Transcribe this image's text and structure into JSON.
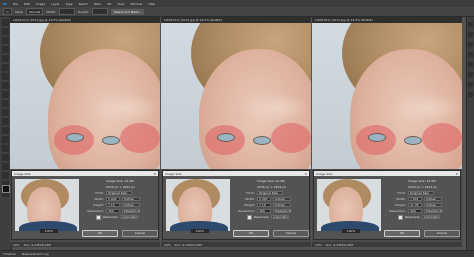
{
  "menu": [
    "File",
    "Edit",
    "Image",
    "Layer",
    "Type",
    "Select",
    "Filter",
    "3D",
    "View",
    "Window",
    "Help"
  ],
  "options": {
    "style_label": "Style:",
    "style_value": "Normal",
    "width_label": "Width:",
    "height_label": "Height:",
    "select_mask": "Select and Mask..."
  },
  "docs": [
    {
      "title": "LIS051017_0013.jpg @ 19.5% (RGB/8)",
      "status_zoom": "19%",
      "status_info": "Doc: 9.23M/9.23M"
    },
    {
      "title": "LIS051017_0013.jpg @ 19.5% (RGB/8)",
      "status_zoom": "19%",
      "status_info": "Doc: 9.23M/9.23M"
    },
    {
      "title": "LIS051017_0013.jpg @ 19.5% (RGB/8)",
      "status_zoom": "19%",
      "status_info": "Doc: 9.23M/9.23M"
    }
  ],
  "dialogs": [
    {
      "title": "Image Size",
      "image_size": "Image Size: 22.9M",
      "dimensions": "2026 px × 2914 px",
      "fit_to": "Original Size",
      "width": "5.000",
      "width_unit": "Inches",
      "height": "7.19",
      "height_unit": "Inches",
      "resolution": "300",
      "res_unit": "Pixels/Inch",
      "resample": "Automatic",
      "zoom": "100%",
      "ok": "OK",
      "cancel": "Cancel"
    },
    {
      "title": "Image Size",
      "image_size": "Image Size: 22.9M",
      "dimensions": "2026 px × 2914 px",
      "fit_to": "Original Size",
      "width": "5.000",
      "width_unit": "Inches",
      "height": "7.19",
      "height_unit": "Inches",
      "resolution": "300",
      "res_unit": "Pixels/Inch",
      "resample": "Automatic",
      "zoom": "100%",
      "ok": "OK",
      "cancel": "Cancel"
    },
    {
      "title": "Image Size",
      "image_size": "Image Size: 22.9M",
      "dimensions": "2026 px × 2914 px",
      "fit_to": "Original Size",
      "width": "7.901",
      "width_unit": "Inches",
      "height": "11.35",
      "height_unit": "Inches",
      "resolution": "300",
      "res_unit": "Pixels/Inch",
      "resample": "Automatic",
      "zoom": "100%",
      "ok": "OK",
      "cancel": "Cancel"
    }
  ],
  "field_labels": {
    "fit_to": "Fit To:",
    "width": "Width:",
    "height": "Height:",
    "resolution": "Resolution:",
    "resample": "Resample"
  },
  "bottom": {
    "timeline": "Timeline",
    "measurement": "Measurement Log"
  }
}
